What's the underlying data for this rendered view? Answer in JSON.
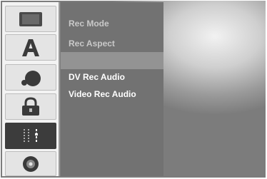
{
  "sidebar": {
    "items": [
      {
        "icon": "screen-icon",
        "active": false
      },
      {
        "icon": "language-icon",
        "active": false
      },
      {
        "icon": "audio-icon",
        "active": false
      },
      {
        "icon": "lock-icon",
        "active": false
      },
      {
        "icon": "recording-icon",
        "active": true
      },
      {
        "icon": "disc-icon",
        "active": false
      }
    ]
  },
  "menu": {
    "items": [
      {
        "label": "Rec Mode",
        "state": "disabled"
      },
      {
        "label": "Rec Aspect",
        "state": "disabled"
      },
      {
        "label": "",
        "state": "highlighted"
      },
      {
        "label": "DV Rec Audio",
        "state": "enabled"
      },
      {
        "label": "Video Rec Audio",
        "state": "enabled"
      }
    ]
  }
}
